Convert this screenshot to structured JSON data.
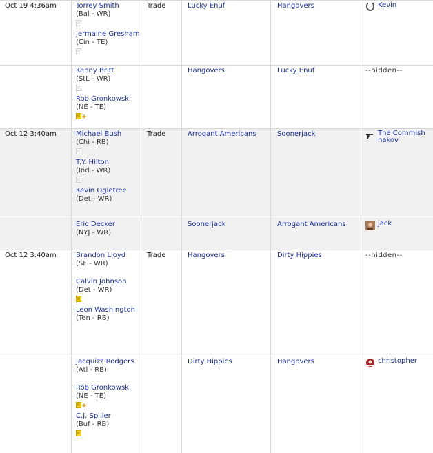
{
  "transactions": [
    {
      "date": "Oct 19 4:36am",
      "type": "Trade",
      "legs": [
        {
          "players": [
            {
              "name": "Torrey Smith",
              "team": "(Bal - WR)",
              "note": "plain"
            },
            {
              "name": "Jermaine Gresham",
              "team": "(Cin - TE)",
              "note": "plain"
            }
          ],
          "from": "Lucky Enuf",
          "to": "Hangovers",
          "owner": "Kevin",
          "owner_icon": "horseshoe-icon"
        },
        {
          "players": [
            {
              "name": "Kenny Britt",
              "team": "(StL - WR)",
              "note": "plain"
            },
            {
              "name": "Rob Gronkowski",
              "team": "(NE - TE)",
              "note": "new"
            }
          ],
          "from": "Hangovers",
          "to": "Lucky Enuf",
          "owner": "--hidden--",
          "owner_icon": ""
        }
      ]
    },
    {
      "date": "Oct 12 3:40am",
      "type": "Trade",
      "legs": [
        {
          "players": [
            {
              "name": "Michael Bush",
              "team": "(Chi - RB)",
              "note": "plain"
            },
            {
              "name": "T.Y. Hilton",
              "team": "(Ind - WR)",
              "note": "plain"
            },
            {
              "name": "Kevin Ogletree",
              "team": "(Det - WR)",
              "note": ""
            }
          ],
          "from": "Arrogant Americans",
          "to": "Soonerjack",
          "owner": "The Commishnakov",
          "owner_icon": "gun-icon"
        },
        {
          "players": [
            {
              "name": "Eric Decker",
              "team": "(NYJ - WR)",
              "note": ""
            }
          ],
          "from": "Soonerjack",
          "to": "Arrogant Americans",
          "owner": "jack",
          "owner_icon": "avatar-icon"
        }
      ]
    },
    {
      "date": "Oct 12 3:40am",
      "type": "Trade",
      "legs": [
        {
          "players": [
            {
              "name": "Brandon Lloyd",
              "team": "(SF - WR)",
              "note": ""
            },
            {
              "name": "Calvin Johnson",
              "team": "(Det - WR)",
              "note": "yellow"
            },
            {
              "name": "Leon Washington",
              "team": "(Ten - RB)",
              "note": ""
            }
          ],
          "from": "Hangovers",
          "to": "Dirty Hippies",
          "owner": "--hidden--",
          "owner_icon": ""
        },
        {
          "players": [
            {
              "name": "Jacquizz Rodgers",
              "team": "(Atl - RB)",
              "note": ""
            },
            {
              "name": "Rob Gronkowski",
              "team": "(NE - TE)",
              "note": "new"
            },
            {
              "name": "C.J. Spiller",
              "team": "(Buf - RB)",
              "note": "yellow"
            }
          ],
          "from": "Dirty Hippies",
          "to": "Hangovers",
          "owner": "christopher",
          "owner_icon": "logo-icon"
        }
      ]
    }
  ]
}
